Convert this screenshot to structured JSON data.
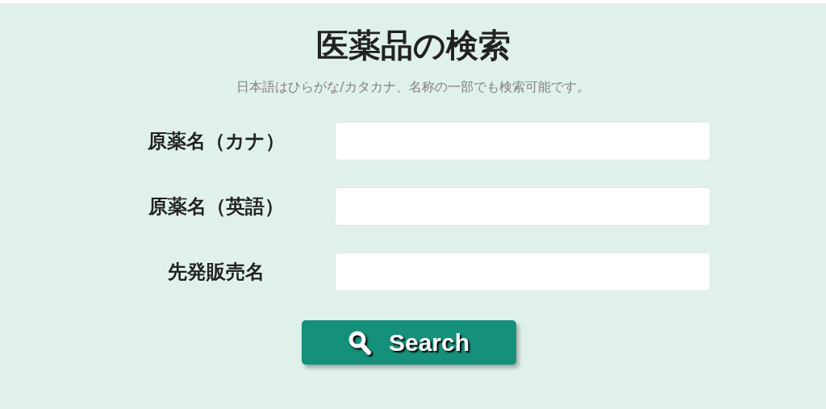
{
  "title": "医薬品の検索",
  "subtitle": "日本語はひらがな/カタカナ、名称の一部でも検索可能です。",
  "fields": [
    {
      "label": "原薬名（カナ）"
    },
    {
      "label": "原薬名（英語）"
    },
    {
      "label": "先発販売名"
    }
  ],
  "button": {
    "label": "Search"
  }
}
